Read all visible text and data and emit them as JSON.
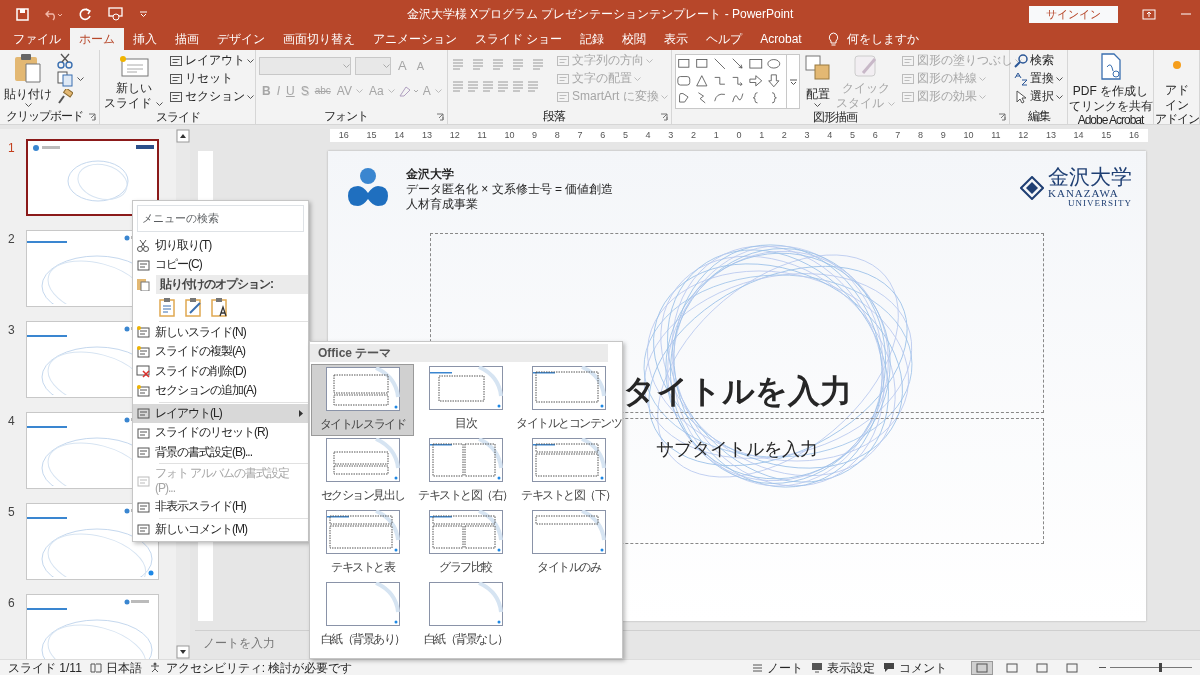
{
  "window": {
    "title": "金沢大学様 Xプログラム プレゼンテーションテンプレート - PowerPoint",
    "sign_in": "サインイン"
  },
  "tabs": [
    {
      "label": "ファイル",
      "selected": false
    },
    {
      "label": "ホーム",
      "selected": true
    },
    {
      "label": "挿入",
      "selected": false
    },
    {
      "label": "描画",
      "selected": false
    },
    {
      "label": "デザイン",
      "selected": false
    },
    {
      "label": "画面切り替え",
      "selected": false
    },
    {
      "label": "アニメーション",
      "selected": false
    },
    {
      "label": "スライド ショー",
      "selected": false
    },
    {
      "label": "記録",
      "selected": false
    },
    {
      "label": "校閲",
      "selected": false
    },
    {
      "label": "表示",
      "selected": false
    },
    {
      "label": "ヘルプ",
      "selected": false
    },
    {
      "label": "Acrobat",
      "selected": false
    }
  ],
  "tell_me": "何をしますか",
  "ribbon": [
    {
      "kind": "clipboard",
      "label": "クリップボード",
      "dialog_launcher": true,
      "paste": "貼り付け"
    },
    {
      "kind": "slides",
      "label": "スライド",
      "new_slide": [
        "新しい",
        "スライド"
      ],
      "items": [
        "レイアウト",
        "リセット",
        "セクション"
      ]
    },
    {
      "kind": "font",
      "label": "フォント",
      "dialog_launcher": true,
      "disabled": true,
      "top_glyphs": [
        "A",
        "A"
      ],
      "glyphs": [
        "B",
        "I",
        "U",
        "S",
        "abc",
        "AV",
        "Aa",
        "A"
      ]
    },
    {
      "kind": "paragraph",
      "label": "段落",
      "dialog_launcher": true,
      "items": [
        {
          "label": "文字列の方向",
          "disabled": true
        },
        {
          "label": "文字の配置",
          "disabled": true
        },
        {
          "label": "SmartArt に変換",
          "disabled": true
        }
      ]
    },
    {
      "kind": "drawing",
      "label": "図形描画",
      "dialog_launcher": true,
      "arrange": "配置",
      "quick_style": {
        "lines": [
          "クイック",
          "スタイル"
        ],
        "disabled": true
      },
      "items": [
        {
          "label": "図形の塗りつぶし",
          "disabled": true
        },
        {
          "label": "図形の枠線",
          "disabled": true
        },
        {
          "label": "図形の効果",
          "disabled": true
        }
      ]
    },
    {
      "kind": "editing",
      "label": "編集",
      "items": [
        "検索",
        "置換",
        "選択"
      ]
    },
    {
      "kind": "acrobat",
      "label": "Adobe Acrobat",
      "button": [
        "PDF を作成し",
        "てリンクを共有"
      ]
    },
    {
      "kind": "addin",
      "label": "アドイン",
      "button": [
        "アド",
        "イン"
      ]
    }
  ],
  "slides": [
    {
      "number": "1",
      "selected": true
    },
    {
      "number": "2",
      "selected": false
    },
    {
      "number": "3",
      "selected": false
    },
    {
      "number": "4",
      "selected": false
    },
    {
      "number": "5",
      "selected": false
    },
    {
      "number": "6",
      "selected": false
    }
  ],
  "ruler": [
    "16",
    "15",
    "14",
    "13",
    "12",
    "11",
    "10",
    "9",
    "8",
    "7",
    "6",
    "5",
    "4",
    "3",
    "2",
    "1",
    "0",
    "1",
    "2",
    "3",
    "4",
    "5",
    "6",
    "7",
    "8",
    "9",
    "10",
    "11",
    "12",
    "13",
    "14",
    "15",
    "16"
  ],
  "slide": {
    "org_name": "金沢大学",
    "program_lines": [
      "データ匿名化 × 文系修士号 = 価値創造",
      "人材育成事業"
    ],
    "brand_name": "金沢大学",
    "brand_latin": "KANAZAWA",
    "brand_sub": "UNIVERSITY",
    "title": "タイトルを入力",
    "subtitle": "サブタイトルを入力"
  },
  "notes": {
    "placeholder": "ノートを入力"
  },
  "context_menu": {
    "search": {
      "placeholder": "メニューの検索"
    },
    "items": [
      {
        "kind": "item",
        "label": "切り取り(T)",
        "disabled": false,
        "selected": false,
        "submenu": false
      },
      {
        "kind": "item",
        "label": "コピー(C)",
        "disabled": false,
        "selected": false,
        "submenu": false
      },
      {
        "kind": "header",
        "label": "貼り付けのオプション:"
      },
      {
        "kind": "paste_options"
      },
      {
        "kind": "separator"
      },
      {
        "kind": "item",
        "label": "新しいスライド(N)",
        "disabled": false,
        "selected": false,
        "submenu": false
      },
      {
        "kind": "item",
        "label": "スライドの複製(A)",
        "disabled": false,
        "selected": false,
        "submenu": false
      },
      {
        "kind": "item",
        "label": "スライドの削除(D)",
        "disabled": false,
        "selected": false,
        "submenu": false
      },
      {
        "kind": "item",
        "label": "セクションの追加(A)",
        "disabled": false,
        "selected": false,
        "submenu": false
      },
      {
        "kind": "separator"
      },
      {
        "kind": "item",
        "label": "レイアウト(L)",
        "disabled": false,
        "selected": true,
        "submenu": true
      },
      {
        "kind": "item",
        "label": "スライドのリセット(R)",
        "disabled": false,
        "selected": false,
        "submenu": false
      },
      {
        "kind": "item",
        "label": "背景の書式設定(B)...",
        "disabled": false,
        "selected": false,
        "submenu": false
      },
      {
        "kind": "separator"
      },
      {
        "kind": "item",
        "label": "フォト アルバムの書式設定(P)...",
        "disabled": true,
        "selected": false,
        "submenu": false
      },
      {
        "kind": "item",
        "label": "非表示スライド(H)",
        "disabled": false,
        "selected": false,
        "submenu": false
      },
      {
        "kind": "separator"
      },
      {
        "kind": "item",
        "label": "新しいコメント(M)",
        "disabled": false,
        "selected": false,
        "submenu": false
      }
    ]
  },
  "layout_menu": {
    "header": "Office テーマ",
    "layouts": [
      {
        "label": "タイトル スライド",
        "selected": true
      },
      {
        "label": "目次",
        "selected": false
      },
      {
        "label": "タイトルとコンテンツ",
        "selected": false
      },
      {
        "label": "セクション見出し",
        "selected": false
      },
      {
        "label": "テキストと図（右）",
        "selected": false
      },
      {
        "label": "テキストと図（下）",
        "selected": false
      },
      {
        "label": "テキストと表",
        "selected": false
      },
      {
        "label": "グラフ比較",
        "selected": false
      },
      {
        "label": "タイトルのみ",
        "selected": false
      },
      {
        "label": "白紙（背景あり）",
        "selected": false
      },
      {
        "label": "白紙（背景なし）",
        "selected": false
      }
    ]
  },
  "status_bar": {
    "slide": "スライド 1/11",
    "language": "日本語",
    "accessibility": "アクセシビリティ: 検討が必要です",
    "notes": "ノート",
    "display": "表示設定",
    "comments": "コメント",
    "views": [
      {
        "selected": true
      },
      {
        "selected": false
      },
      {
        "selected": false
      },
      {
        "selected": false
      }
    ],
    "zoom": {
      "level": 0.6
    }
  }
}
